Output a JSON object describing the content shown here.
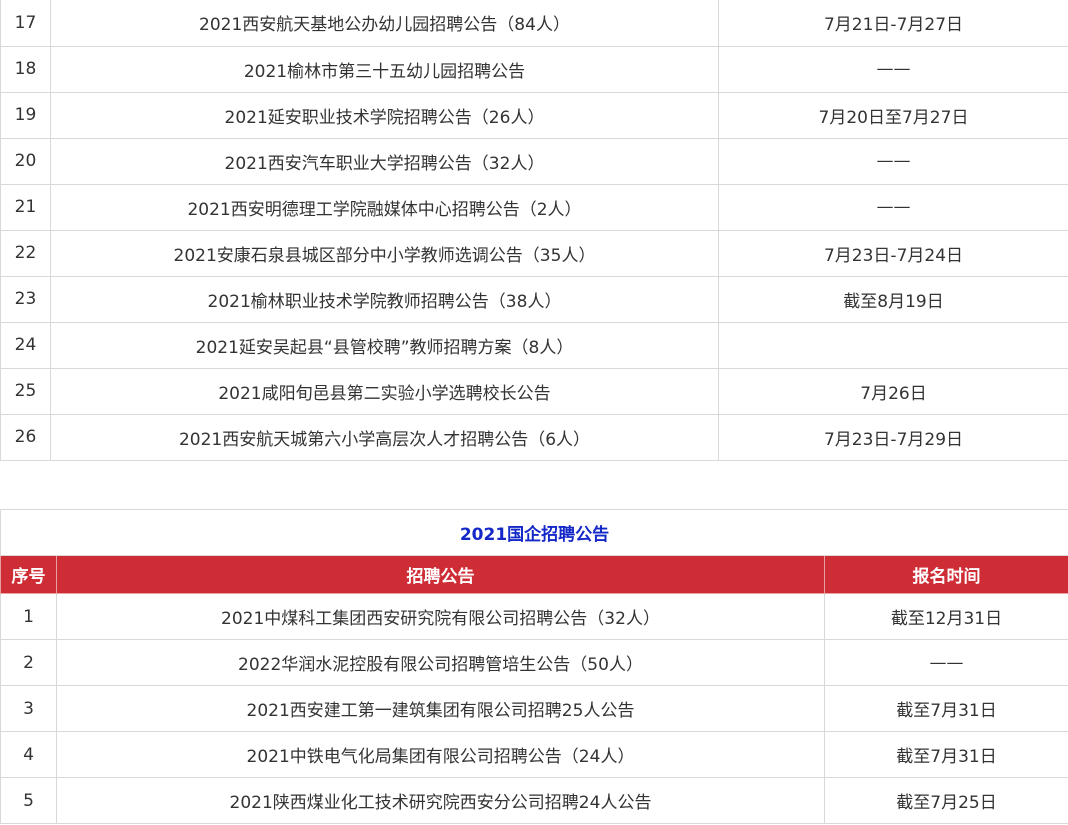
{
  "top_table": {
    "rows": [
      {
        "no": "17",
        "title": "2021西安航天基地公办幼儿园招聘公告（84人）",
        "date": "7月21日-7月27日"
      },
      {
        "no": "18",
        "title": "2021榆林市第三十五幼儿园招聘公告",
        "date": "——"
      },
      {
        "no": "19",
        "title": "2021延安职业技术学院招聘公告（26人）",
        "date": "7月20日至7月27日"
      },
      {
        "no": "20",
        "title": "2021西安汽车职业大学招聘公告（32人）",
        "date": "——"
      },
      {
        "no": "21",
        "title": "2021西安明德理工学院融媒体中心招聘公告（2人）",
        "date": "——"
      },
      {
        "no": "22",
        "title": "2021安康石泉县城区部分中小学教师选调公告（35人）",
        "date": "7月23日-7月24日"
      },
      {
        "no": "23",
        "title": "2021榆林职业技术学院教师招聘公告（38人）",
        "date": "截至8月19日"
      },
      {
        "no": "24",
        "title": "2021延安吴起县“县管校聘”教师招聘方案（8人）",
        "date": ""
      },
      {
        "no": "25",
        "title": "2021咸阳旬邑县第二实验小学选聘校长公告",
        "date": "7月26日"
      },
      {
        "no": "26",
        "title": "2021西安航天城第六小学高层次人才招聘公告（6人）",
        "date": "7月23日-7月29日"
      }
    ]
  },
  "bottom_table": {
    "title": "2021国企招聘公告",
    "headers": {
      "no": "序号",
      "title": "招聘公告",
      "date": "报名时间"
    },
    "rows": [
      {
        "no": "1",
        "title": "2021中煤科工集团西安研究院有限公司招聘公告（32人）",
        "date": "截至12月31日"
      },
      {
        "no": "2",
        "title": "2022华润水泥控股有限公司招聘管培生公告（50人）",
        "date": "——"
      },
      {
        "no": "3",
        "title": "2021西安建工第一建筑集团有限公司招聘25人公告",
        "date": "截至7月31日"
      },
      {
        "no": "4",
        "title": "2021中铁电气化局集团有限公司招聘公告（24人）",
        "date": "截至7月31日"
      },
      {
        "no": "5",
        "title": "2021陕西煤业化工技术研究院西安分公司招聘24人公告",
        "date": "截至7月25日"
      }
    ]
  },
  "colors": {
    "header_bg": "#cf2d36",
    "title_text": "#1428c8",
    "border": "#d9d9d9"
  }
}
